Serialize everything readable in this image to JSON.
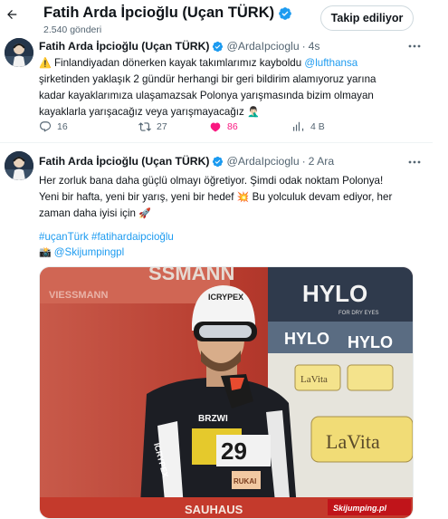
{
  "header": {
    "title": "Fatih Arda İpcioğlu (Uçan TÜRK)",
    "post_count": "2.540 gönderi",
    "follow_button": "Takip ediliyor",
    "colors": {
      "verified": "#1d9bf0",
      "like": "#f91880",
      "link": "#1d9bf0",
      "muted": "#536471"
    }
  },
  "tweets": [
    {
      "author": "Fatih Arda İpcioğlu (Uçan TÜRK)",
      "handle": "@ArdaIpcioglu",
      "dot": "·",
      "time": "4s",
      "line1_icon": "⚠️",
      "line1": "Finlandiyadan dönerken kayak takımlarımız kayboldu",
      "line1_mention": "@lufthansa",
      "line2": "şirketinden yaklaşık 2 gündür herhangi bir geri bildirim alamıyoruz yarına",
      "line3": "kadar kayaklarımıza ulaşamazsak Polonya yarışmasında bizim olmayan",
      "line4": "kayaklarla yarışacağız veya yarışmayacağız",
      "line4_emoji": "🤦🏻‍♂️",
      "replies": "16",
      "retweets": "27",
      "likes": "86",
      "views": "4 B"
    },
    {
      "author": "Fatih Arda İpcioğlu (Uçan TÜRK)",
      "handle": "@ArdaIpcioglu",
      "dot": "·",
      "time": "2 Ara",
      "line1": "Her zorluk bana daha güçlü olmayı öğretiyor. Şimdi odak noktam Polonya!",
      "line2": "Yeni bir hafta, yeni bir yarış, yeni bir hedef",
      "line2_emoji": "💥",
      "line2b": "Bu yolculuk devam ediyor, her",
      "line3": "zaman daha iyisi için",
      "line3_emoji": "🚀",
      "hashtags": "#uçanTürk #fatihardaipcioğlu",
      "photo_credit_emoji": "📸",
      "photo_credit": "@Skijumpingpl",
      "image": {
        "description_icon": "ski-jumper-photo",
        "bib_number": "29",
        "brand_texts": [
          "HYLO",
          "FOR DRY EYES",
          "HYLO",
          "HYLO",
          "LaVita",
          "LaVita",
          "ICRYPEX",
          "VIESSMANN",
          "RUKAI",
          "SAUHAUS",
          "BRZWI"
        ],
        "watermark": "Skijumping.pl"
      }
    }
  ]
}
